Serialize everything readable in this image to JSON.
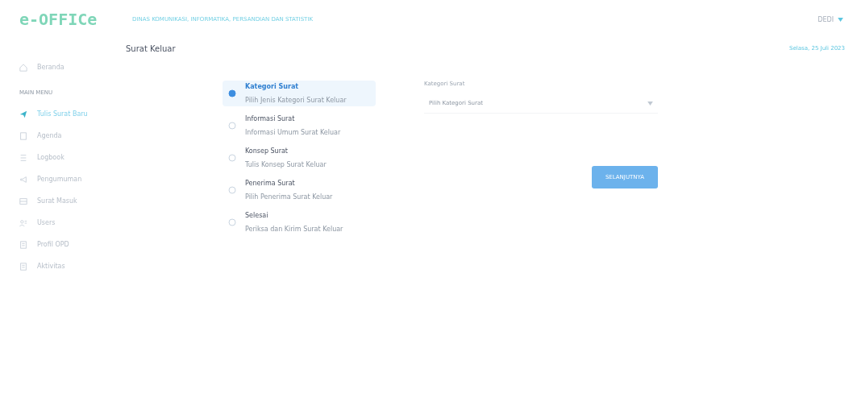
{
  "logo": {
    "text": "e-OFFICe"
  },
  "header": {
    "agency": "DINAS KOMUNIKASI, INFORMATIKA, PERSANDIAN DAN STATISTIK",
    "user": "DEDI"
  },
  "sidebar": {
    "home": {
      "label": "Beranda",
      "selected": false
    },
    "section": "MAIN MENU",
    "items": [
      {
        "label": "Tulis Surat Baru",
        "kind": "send",
        "selected": true
      },
      {
        "label": "Agenda",
        "kind": "book",
        "selected": false
      },
      {
        "label": "Logbook",
        "kind": "list",
        "selected": false
      },
      {
        "label": "Pengumuman",
        "kind": "bell",
        "selected": false
      },
      {
        "label": "Surat Masuk",
        "kind": "inbox",
        "selected": false
      },
      {
        "label": "Users",
        "kind": "users",
        "selected": false
      },
      {
        "label": "Profil OPD",
        "kind": "doc",
        "selected": false
      },
      {
        "label": "Aktivitas",
        "kind": "doc",
        "selected": false
      }
    ]
  },
  "page": {
    "title": "Surat Keluar",
    "date": "Selasa, 25 Juli 2023"
  },
  "steps": [
    {
      "title": "Kategori Surat",
      "subtitle": "Pilih Jenis Kategori Surat Keluar",
      "selected": true
    },
    {
      "title": "Informasi Surat",
      "subtitle": "Informasi Umum Surat Keluar",
      "selected": false
    },
    {
      "title": "Konsep Surat",
      "subtitle": "Tulis Konsep Surat Keluar",
      "selected": false
    },
    {
      "title": "Penerima Surat",
      "subtitle": "Pilih Penerima Surat Keluar",
      "selected": false
    },
    {
      "title": "Selesai",
      "subtitle": "Periksa dan Kirim Surat Keluar",
      "selected": false
    }
  ],
  "form": {
    "label": "Kategori Surat",
    "select": {
      "placeholder": "Pilih Kategori Surat"
    },
    "button": "SELANJUTNYA"
  }
}
